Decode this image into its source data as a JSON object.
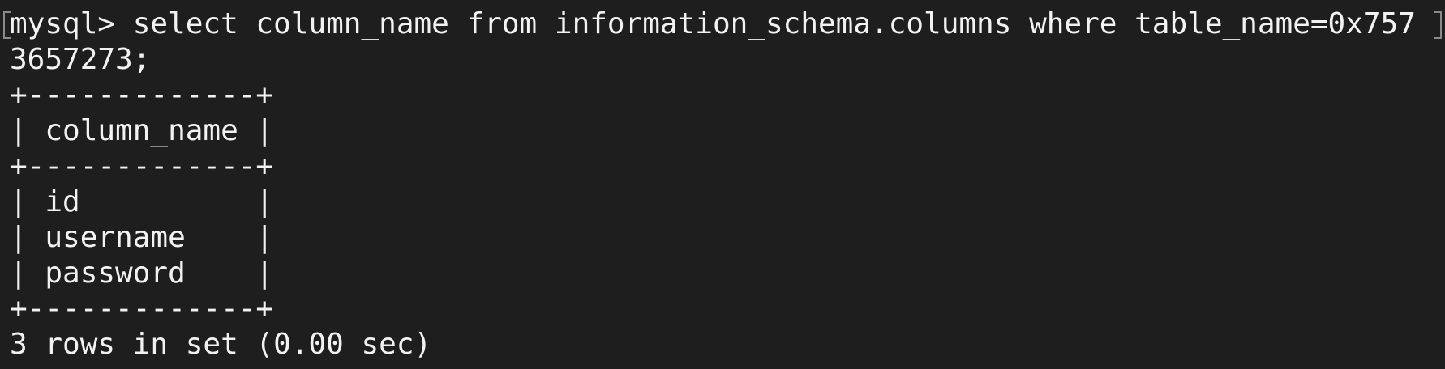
{
  "terminal": {
    "command_line_1": "mysql> select column_name from information_schema.columns where table_name=0x757",
    "command_line_2": "3657273;",
    "table": {
      "border": "+-------------+",
      "header_row": "| column_name |",
      "rows": [
        "| id          |",
        "| username    |",
        "| password    |"
      ]
    },
    "footer": "3 rows in set (0.00 sec)"
  }
}
